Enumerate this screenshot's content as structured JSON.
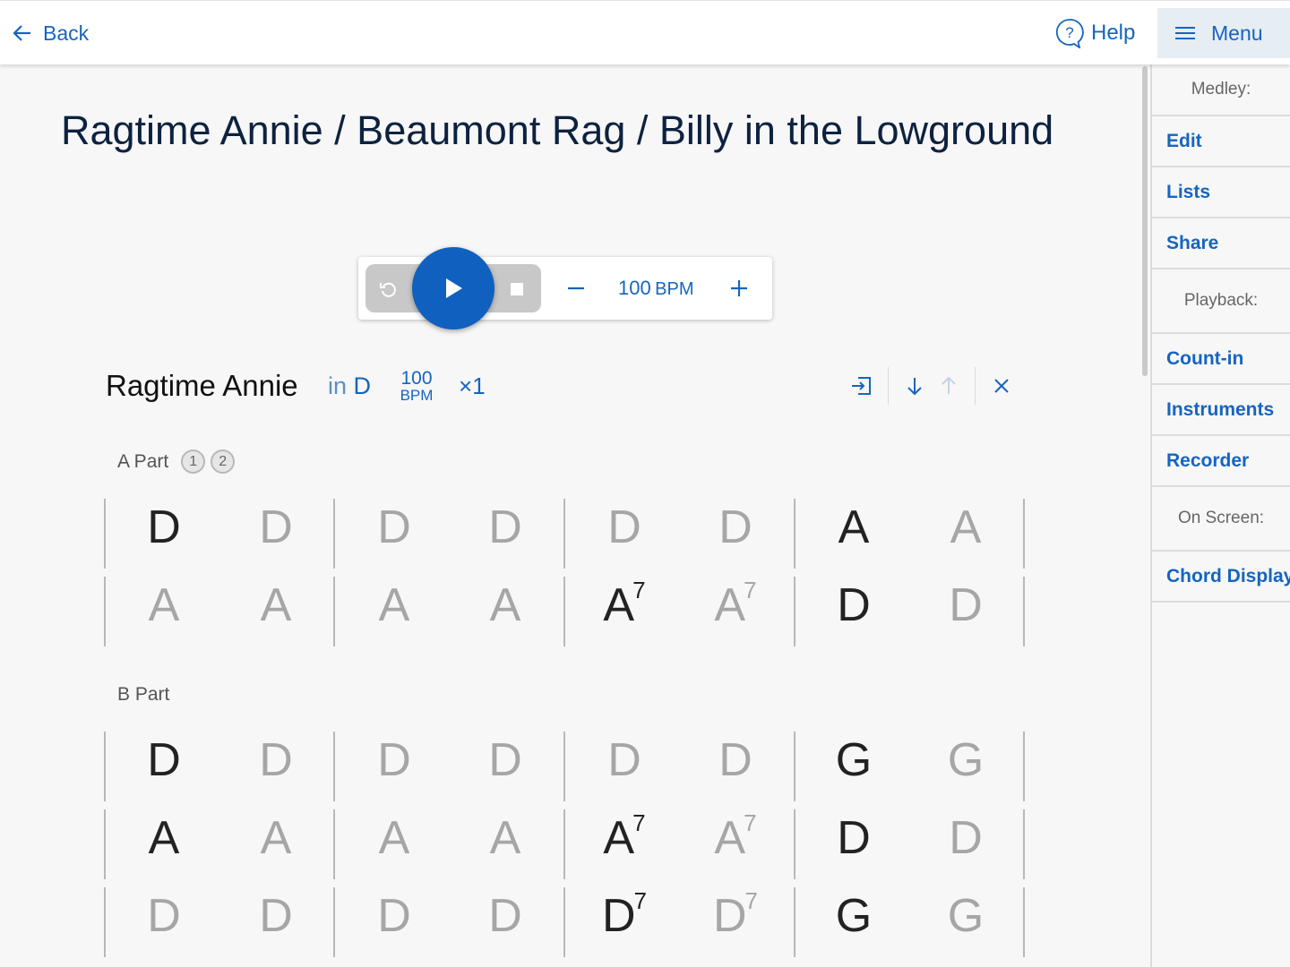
{
  "header": {
    "back_label": "Back",
    "help_label": "Help",
    "menu_label": "Menu"
  },
  "sidebar": {
    "medley_heading": "Medley:",
    "medley_items": [
      {
        "label": "Edit"
      },
      {
        "label": "Lists"
      },
      {
        "label": "Share"
      }
    ],
    "playback_heading": "Playback:",
    "playback_items": [
      {
        "label": "Count-in"
      },
      {
        "label": "Instruments"
      },
      {
        "label": "Recorder"
      }
    ],
    "onscreen_heading": "On Screen:",
    "onscreen_items": [
      {
        "label": "Chord Display"
      }
    ]
  },
  "page": {
    "title": "Ragtime Annie / Beaumont Rag / Billy in the Lowground"
  },
  "transport": {
    "bpm_value": "100",
    "bpm_unit": "BPM",
    "icons": [
      "reset-icon",
      "play-icon",
      "stop-icon",
      "minus-icon",
      "plus-icon"
    ]
  },
  "tune": {
    "name": "Ragtime Annie",
    "key_prefix": "in",
    "key": "D",
    "bpm_value": "100",
    "bpm_unit": "BPM",
    "repeat_symbol": "×",
    "repeat_count": "1",
    "action_icons": [
      "jump-to-icon",
      "move-down-icon",
      "move-up-icon",
      "remove-icon"
    ]
  },
  "parts": [
    {
      "label": "A Part",
      "badges": [
        "1",
        "2"
      ],
      "rows": [
        [
          {
            "root": "D",
            "sup": "",
            "active": true
          },
          {
            "root": "D",
            "sup": "",
            "active": false
          },
          {
            "root": "D",
            "sup": "",
            "active": false
          },
          {
            "root": "D",
            "sup": "",
            "active": false
          },
          {
            "root": "D",
            "sup": "",
            "active": false
          },
          {
            "root": "D",
            "sup": "",
            "active": false
          },
          {
            "root": "A",
            "sup": "",
            "active": true
          },
          {
            "root": "A",
            "sup": "",
            "active": false
          }
        ],
        [
          {
            "root": "A",
            "sup": "",
            "active": false
          },
          {
            "root": "A",
            "sup": "",
            "active": false
          },
          {
            "root": "A",
            "sup": "",
            "active": false
          },
          {
            "root": "A",
            "sup": "",
            "active": false
          },
          {
            "root": "A",
            "sup": "7",
            "active": true
          },
          {
            "root": "A",
            "sup": "7",
            "active": false
          },
          {
            "root": "D",
            "sup": "",
            "active": true
          },
          {
            "root": "D",
            "sup": "",
            "active": false
          }
        ]
      ]
    },
    {
      "label": "B Part",
      "badges": [],
      "rows": [
        [
          {
            "root": "D",
            "sup": "",
            "active": true
          },
          {
            "root": "D",
            "sup": "",
            "active": false
          },
          {
            "root": "D",
            "sup": "",
            "active": false
          },
          {
            "root": "D",
            "sup": "",
            "active": false
          },
          {
            "root": "D",
            "sup": "",
            "active": false
          },
          {
            "root": "D",
            "sup": "",
            "active": false
          },
          {
            "root": "G",
            "sup": "",
            "active": true
          },
          {
            "root": "G",
            "sup": "",
            "active": false
          }
        ],
        [
          {
            "root": "A",
            "sup": "",
            "active": true
          },
          {
            "root": "A",
            "sup": "",
            "active": false
          },
          {
            "root": "A",
            "sup": "",
            "active": false
          },
          {
            "root": "A",
            "sup": "",
            "active": false
          },
          {
            "root": "A",
            "sup": "7",
            "active": true
          },
          {
            "root": "A",
            "sup": "7",
            "active": false
          },
          {
            "root": "D",
            "sup": "",
            "active": true
          },
          {
            "root": "D",
            "sup": "",
            "active": false
          }
        ],
        [
          {
            "root": "D",
            "sup": "",
            "active": false
          },
          {
            "root": "D",
            "sup": "",
            "active": false
          },
          {
            "root": "D",
            "sup": "",
            "active": false
          },
          {
            "root": "D",
            "sup": "",
            "active": false
          },
          {
            "root": "D",
            "sup": "7",
            "active": true
          },
          {
            "root": "D",
            "sup": "7",
            "active": false
          },
          {
            "root": "G",
            "sup": "",
            "active": true
          },
          {
            "root": "G",
            "sup": "",
            "active": false
          }
        ]
      ]
    }
  ],
  "colors": {
    "accent": "#1565c0",
    "play_button": "#1060c0",
    "title": "#0d2240",
    "chord_active": "#222222",
    "chord_muted": "#a6a6a6"
  }
}
